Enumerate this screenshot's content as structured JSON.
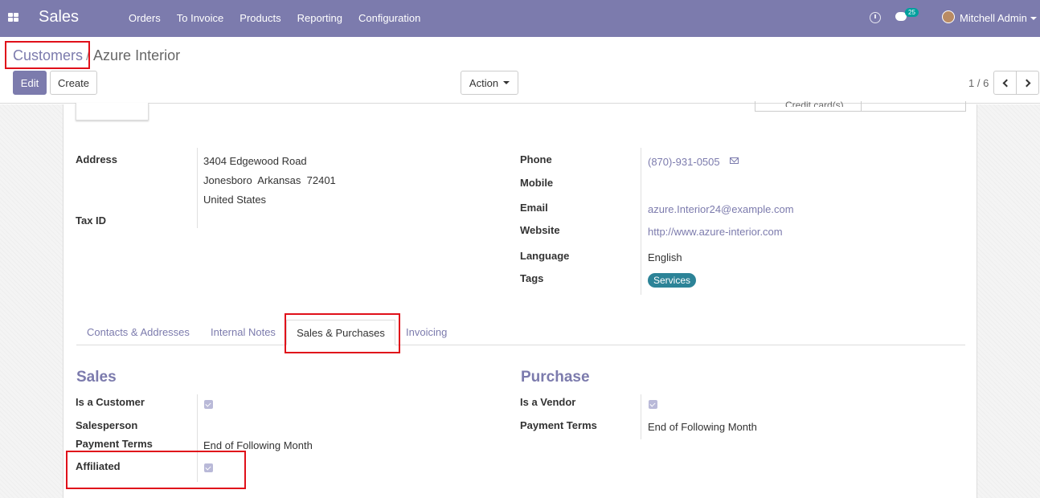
{
  "navbar": {
    "brand": "Sales",
    "menu": [
      "Orders",
      "To Invoice",
      "Products",
      "Reporting",
      "Configuration"
    ],
    "chat_count": "25",
    "user_name": "Mitchell Admin",
    "color": "#7c7bad"
  },
  "breadcrumb": {
    "parent": "Customers",
    "separator": "/",
    "current": "Azure Interior"
  },
  "toolbar": {
    "edit_label": "Edit",
    "create_label": "Create",
    "action_label": "Action",
    "pager": "1 / 6"
  },
  "smart_buttons": {
    "credit_card": "Credit card(s)"
  },
  "address": {
    "label": "Address",
    "line1": "3404 Edgewood Road",
    "line2": "Jonesboro  Arkansas  72401",
    "line3": "United States"
  },
  "tax_id": {
    "label": "Tax ID",
    "value": ""
  },
  "contact": {
    "phone_label": "Phone",
    "phone": "(870)-931-0505",
    "mobile_label": "Mobile",
    "email_label": "Email",
    "email": "azure.Interior24@example.com",
    "website_label": "Website",
    "website": "http://www.azure-interior.com",
    "language_label": "Language",
    "language": "English",
    "tags_label": "Tags",
    "tag": "Services"
  },
  "tabs": [
    {
      "label": "Contacts & Addresses",
      "active": false
    },
    {
      "label": "Internal Notes",
      "active": false
    },
    {
      "label": "Sales & Purchases",
      "active": true
    },
    {
      "label": "Invoicing",
      "active": false
    }
  ],
  "sales": {
    "title": "Sales",
    "is_customer_label": "Is a Customer",
    "is_customer": true,
    "salesperson_label": "Salesperson",
    "payment_terms_label": "Payment Terms",
    "payment_terms": "End of Following Month",
    "affiliated_label": "Affiliated",
    "affiliated": true
  },
  "purchase": {
    "title": "Purchase",
    "is_vendor_label": "Is a Vendor",
    "is_vendor": true,
    "payment_terms_label": "Payment Terms",
    "payment_terms": "End of Following Month"
  }
}
